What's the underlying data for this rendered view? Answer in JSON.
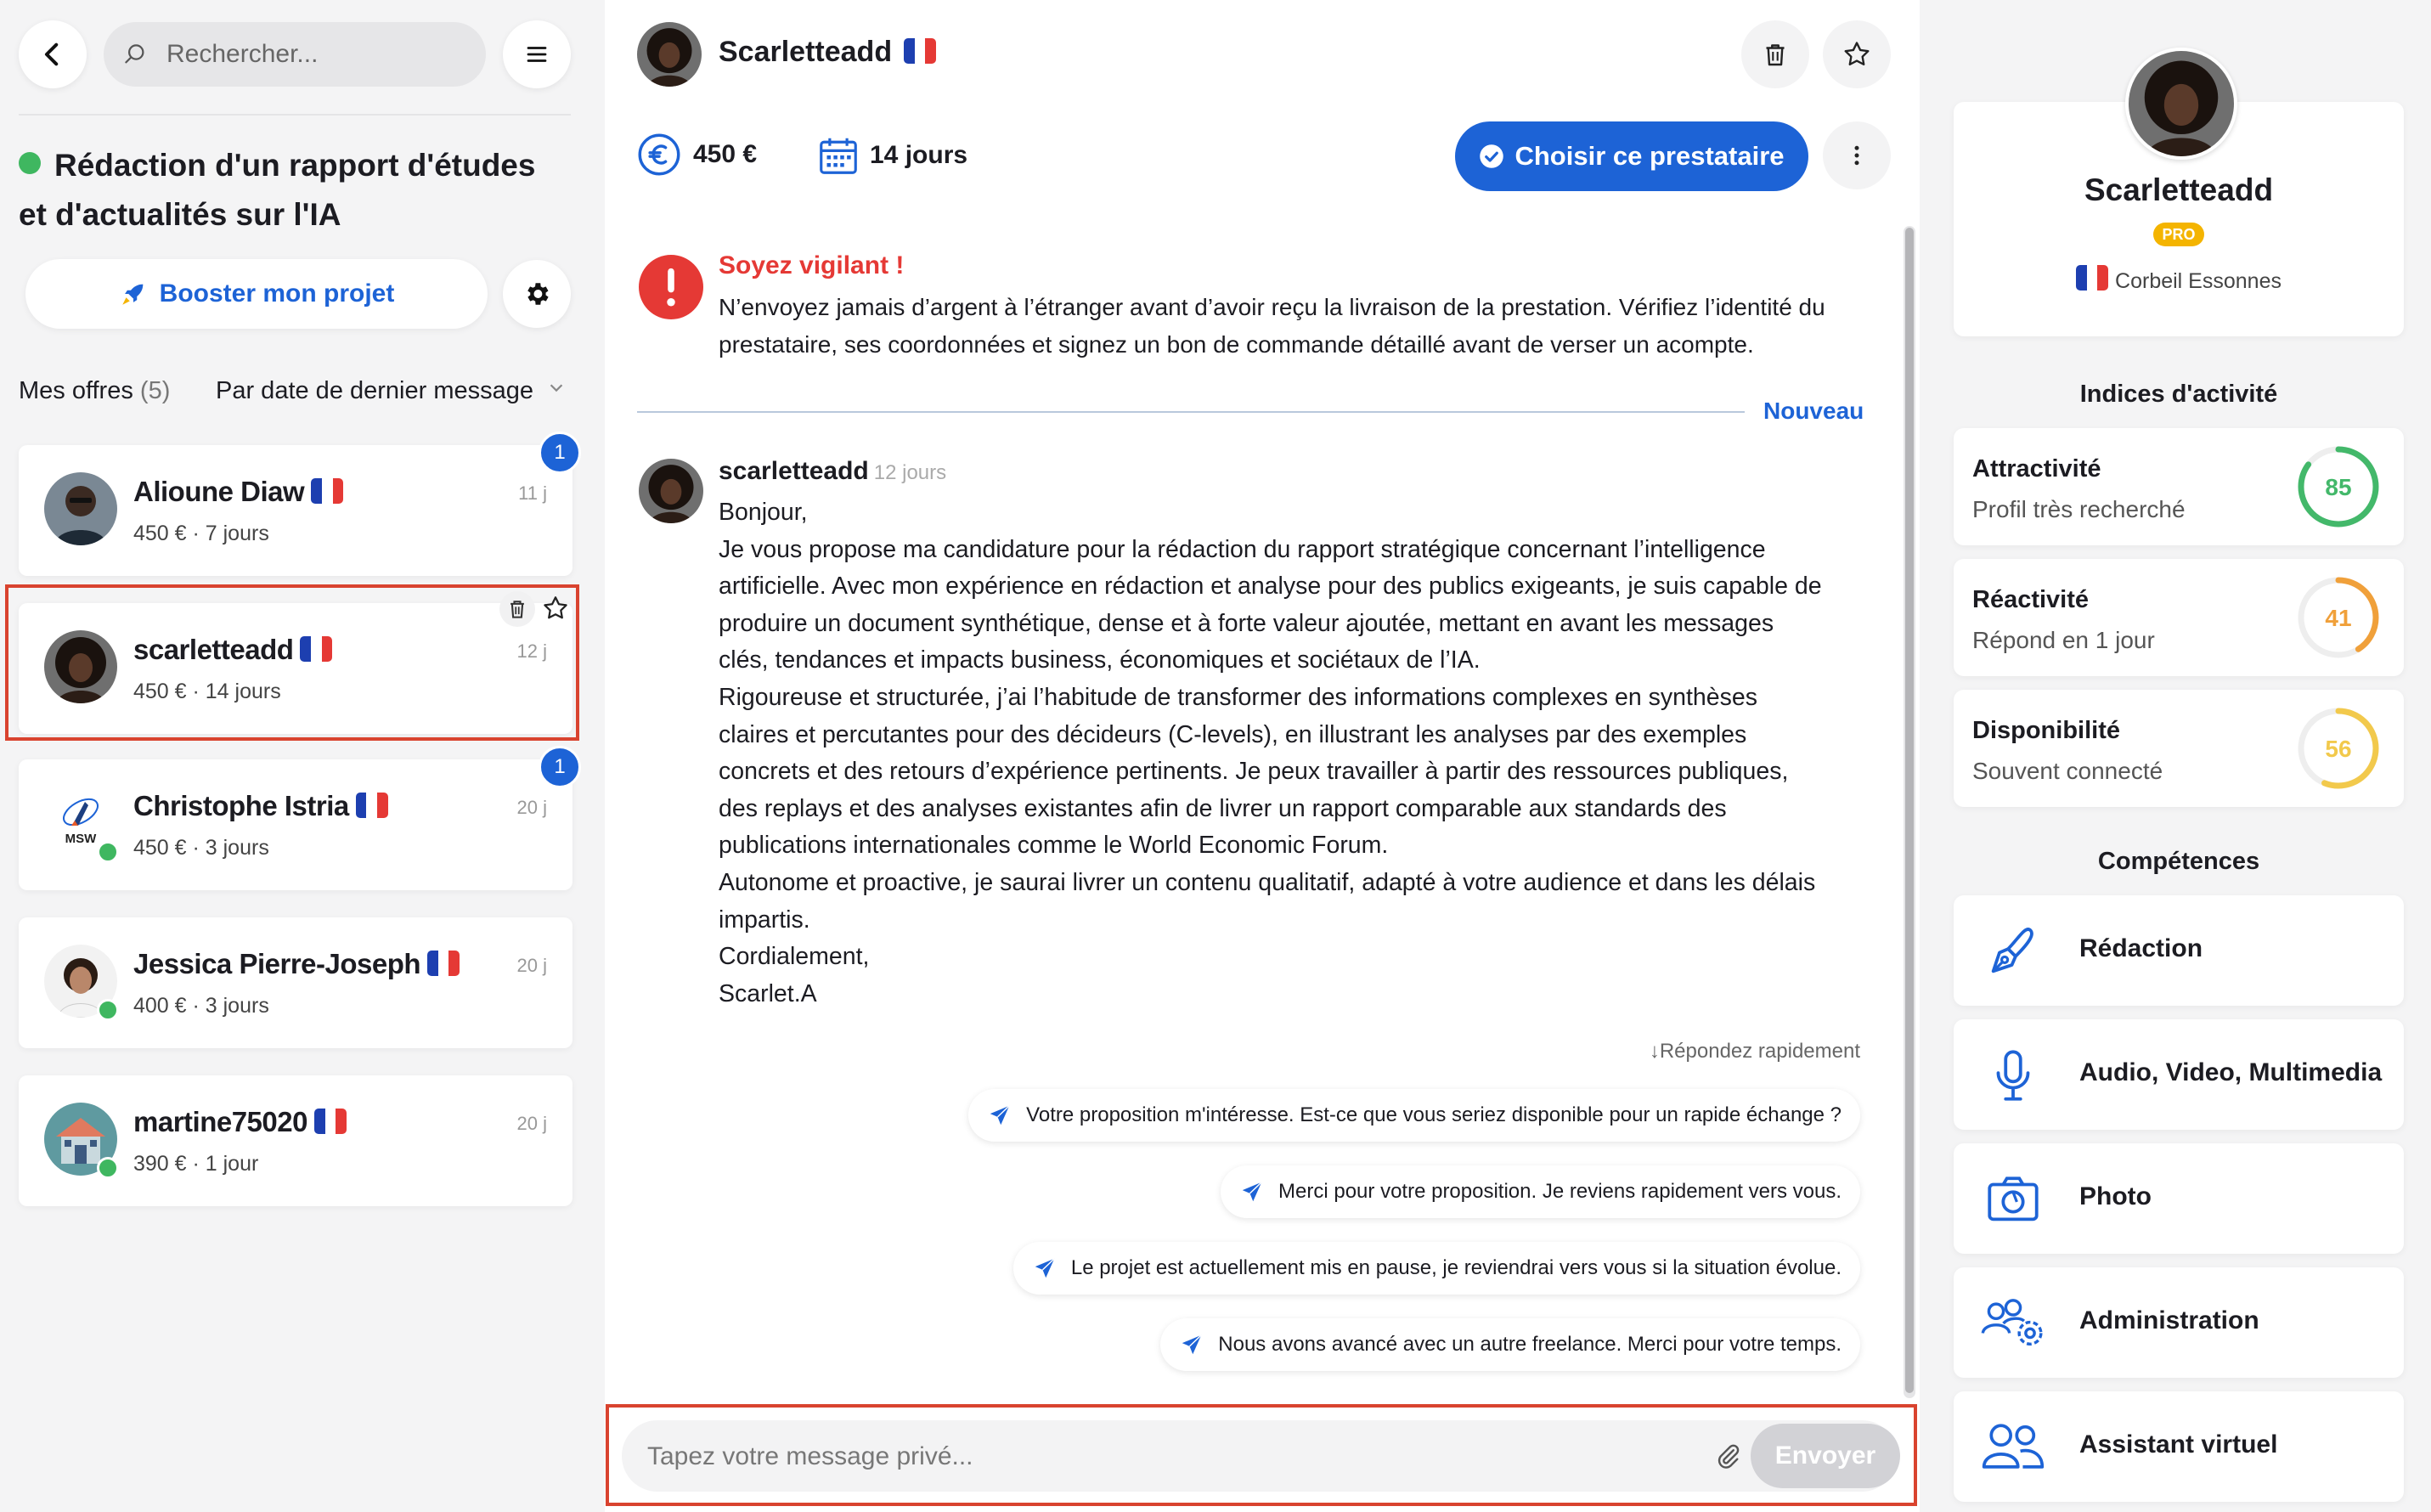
{
  "left": {
    "search_placeholder": "Rechercher...",
    "project_title": "Rédaction d'un rapport d'études et d'actualités sur l'IA",
    "boost_label": "Booster mon projet",
    "offers_label": "Mes offres",
    "offers_count": "(5)",
    "sort_label": "Par date de dernier message",
    "offers": [
      {
        "name": "Alioune Diaw",
        "meta": "450 € · 7 jours",
        "age": "11 j",
        "badge": "1"
      },
      {
        "name": "scarletteadd",
        "meta": "450 € · 14 jours",
        "age": "12 j"
      },
      {
        "name": "Christophe Istria",
        "meta": "450 € · 3 jours",
        "age": "20 j",
        "badge": "1"
      },
      {
        "name": "Jessica Pierre-Joseph",
        "meta": "400 € · 3 jours",
        "age": "20 j"
      },
      {
        "name": "martine75020",
        "meta": "390 € · 1 jour",
        "age": "20 j"
      }
    ],
    "msw_logo_text": "MSW"
  },
  "conversation": {
    "name": "Scarletteadd",
    "price": "450 €",
    "duration": "14 jours",
    "choose_label": "Choisir ce prestataire",
    "warning_title": "Soyez vigilant !",
    "warning_text": "N’envoyez jamais d’argent à l’étranger avant d’avoir reçu la livraison de la prestation. Vérifiez l’identité du prestataire, ses coordonnées et signez un bon de commande détaillé avant de verser un acompte.",
    "new_label": "Nouveau",
    "message_author": "scarletteadd",
    "message_time": "12 jours",
    "message_lines": [
      "Bonjour,",
      "Je vous propose ma candidature pour la rédaction du rapport stratégique concernant l’intelligence",
      "artificielle. Avec mon expérience en rédaction et analyse pour des publics exigeants, je suis capable de",
      "produire un document synthétique, dense et à forte valeur ajoutée, mettant en avant les messages",
      "clés, tendances et impacts business, économiques et sociétaux de l’IA.",
      "Rigoureuse et structurée, j’ai l’habitude de transformer des informations complexes en synthèses",
      "claires et percutantes pour des décideurs (C-levels), en illustrant les analyses par des exemples",
      "concrets et des retours d’expérience pertinents. Je peux travailler à partir des ressources publiques,",
      "des replays et des analyses existantes afin de livrer un rapport comparable aux standards des",
      "publications internationales comme le World Economic Forum.",
      "Autonome et proactive, je saurai livrer un contenu qualitatif, adapté à votre audience et dans les délais",
      "impartis.",
      "Cordialement,",
      "Scarlet.A"
    ],
    "quick_reply_header": "↓Répondez rapidement",
    "quick_replies": [
      "Votre proposition m'intéresse. Est-ce que vous seriez disponible pour un rapide échange ?",
      "Merci pour votre proposition. Je reviens rapidement vers vous.",
      "Le projet est actuellement mis en pause, je reviendrai vers vous si la situation évolue.",
      "Nous avons avancé avec un autre freelance. Merci pour votre temps."
    ],
    "composer_placeholder": "Tapez votre message privé...",
    "send_label": "Envoyer"
  },
  "profile": {
    "name": "Scarletteadd",
    "pro_label": "PRO",
    "location": "Corbeil Essonnes",
    "activity_title": "Indices d'activité",
    "activity": [
      {
        "title": "Attractivité",
        "subtitle": "Profil très recherché",
        "score": "85",
        "value": 0.85,
        "color": "#43b86a"
      },
      {
        "title": "Réactivité",
        "subtitle": "Répond en 1 jour",
        "score": "41",
        "value": 0.41,
        "color": "#f0a03a"
      },
      {
        "title": "Disponibilité",
        "subtitle": "Souvent connecté",
        "score": "56",
        "value": 0.56,
        "color": "#f2c94c"
      }
    ],
    "skills_title": "Compétences",
    "skills": [
      {
        "label": "Rédaction",
        "icon": "pen-nib-icon"
      },
      {
        "label": "Audio, Video, Multimedia",
        "icon": "microphone-icon"
      },
      {
        "label": "Photo",
        "icon": "camera-icon"
      },
      {
        "label": "Administration",
        "icon": "users-gear-icon"
      },
      {
        "label": "Assistant virtuel",
        "icon": "two-users-icon"
      }
    ]
  },
  "colors": {
    "accent": "#1d63d6",
    "warning": "#e53935",
    "online": "#3fb760"
  }
}
